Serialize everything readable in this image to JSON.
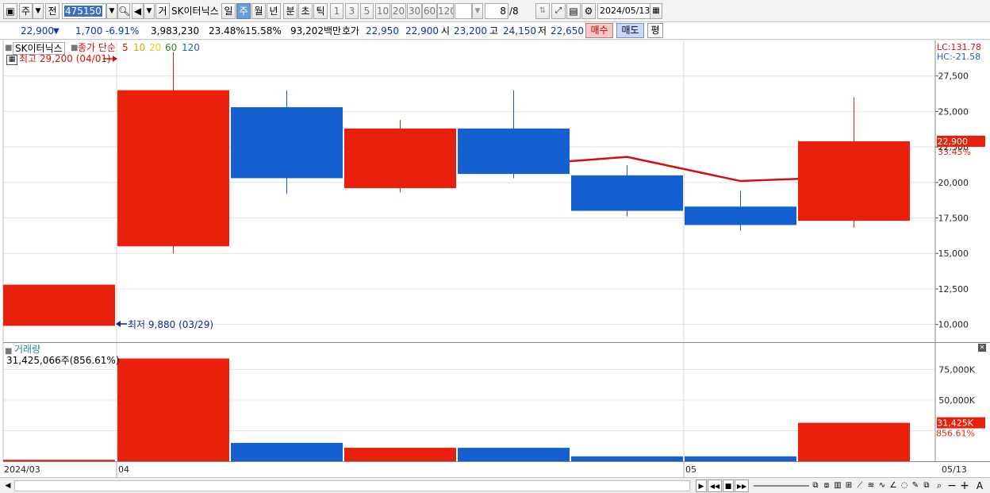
{
  "toolbar": {
    "period_label": "주",
    "prev_label": "전",
    "code": "475150",
    "sound_label": "◀",
    "trade_label": "거",
    "stock_name": "SK이터닉스",
    "periods": [
      "일",
      "주",
      "월",
      "년",
      "분",
      "초",
      "틱"
    ],
    "intervals": [
      "1",
      "3",
      "5",
      "10",
      "20",
      "30",
      "60",
      "120"
    ],
    "count": "8",
    "count_total": "/8",
    "date": "2024/05/13"
  },
  "info": {
    "price": "22,900",
    "price_arrow": "▼",
    "change": "1,700",
    "change_pct": "-6.91%",
    "volume": "3,983,230",
    "turnover_pct": "23.48%",
    "ratio_pct": "15.58%",
    "amount": "93,202백만",
    "quote_label": "호가",
    "quote_ask": "22,950",
    "quote_bid": "22,900",
    "open_label": "시",
    "open": "23,200",
    "high_label": "고",
    "high": "24,150",
    "low_label": "저",
    "low": "22,650",
    "buy_label": "매수",
    "sell_label": "매도",
    "flat_label": "평"
  },
  "legend": {
    "stock": "SK이터닉스",
    "ma_label": "종가 단순",
    "ma_periods": [
      "5",
      "10",
      "20",
      "60",
      "120"
    ],
    "ma_colors": [
      "#d01010",
      "#e0a000",
      "#e8d000",
      "#2a8a2a",
      "#2060c0"
    ],
    "high_note": "최고 29,200 (04/01)",
    "low_note": "최저 9,880 (03/29)",
    "lc": "LC:131.78",
    "hc": "HC:-21.58",
    "volume_title": "거래량",
    "volume_note": "31,425,066주(856.61%)"
  },
  "chart_data": {
    "type": "candlestick",
    "x": [
      "2024/03 wk5",
      "04 wk1",
      "04 wk2",
      "04 wk3",
      "04 wk4",
      "05 wk1",
      "05 wk2",
      "05 wk3"
    ],
    "open": [
      9900,
      15500,
      25300,
      19600,
      20600,
      20500,
      17000,
      17300
    ],
    "high": [
      12800,
      29200,
      26500,
      24400,
      26500,
      21200,
      19400,
      26000
    ],
    "low": [
      9880,
      15000,
      19200,
      19300,
      20300,
      17600,
      16600,
      16800
    ],
    "close": [
      12800,
      26500,
      20300,
      23800,
      23800,
      18000,
      18300,
      22900
    ],
    "candle_color": [
      "up",
      "up",
      "down",
      "up",
      "down",
      "down",
      "down",
      "up"
    ],
    "ma5": [
      null,
      null,
      null,
      null,
      21200,
      21800,
      20100,
      20400
    ],
    "volume": [
      1200000,
      84000000,
      15000000,
      11000000,
      11000000,
      4000000,
      4000000,
      31425066
    ],
    "price_axis": {
      "min": 8750,
      "max": 30000,
      "ticks": [
        "27,500",
        "25,000",
        "22,500",
        "20,000",
        "17,500",
        "15,000",
        "12,500",
        "10,000"
      ]
    },
    "volume_axis": {
      "max": 85000000,
      "ticks": [
        "75,000K",
        "50,000K"
      ]
    },
    "x_labels": [
      "2024/03",
      "04",
      "05",
      "05/13"
    ],
    "current_price_label": "22,900",
    "current_price_pct": "33.45%",
    "current_volume_label": "31,425K",
    "current_volume_pct": "856.61%",
    "up_color": "#e8200c",
    "down_color": "#1560d0",
    "ma_color": "#d01010"
  },
  "bottom": {
    "play_label": "▶",
    "rew_label": "◀◀",
    "stop_label": "■",
    "ff_label": "▶▶",
    "zoom_out_label": "−",
    "zoom_in_label": "+",
    "auto_label": "A"
  }
}
